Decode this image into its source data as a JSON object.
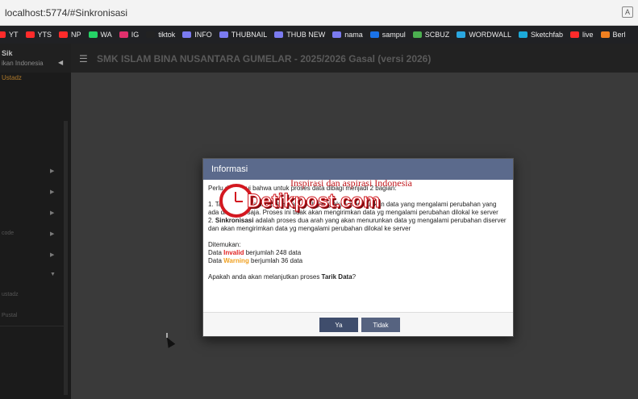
{
  "browser": {
    "url": "localhost:5774/#Sinkronisasi",
    "translate_icon": "translate-icon"
  },
  "bookmarks": [
    {
      "label": "YT",
      "color": "#ff2b2b"
    },
    {
      "label": "YTS",
      "color": "#ff2b2b"
    },
    {
      "label": "NP",
      "color": "#ff2b2b"
    },
    {
      "label": "WA",
      "color": "#25d366"
    },
    {
      "label": "IG",
      "color": "#e1306c"
    },
    {
      "label": "tiktok",
      "color": "#222222"
    },
    {
      "label": "INFO",
      "color": "#7b7bf0"
    },
    {
      "label": "THUBNAIL",
      "color": "#7b7bf0"
    },
    {
      "label": "THUB NEW",
      "color": "#7b7bf0"
    },
    {
      "label": "nama",
      "color": "#7b7bf0"
    },
    {
      "label": "sampul",
      "color": "#1a73e8"
    },
    {
      "label": "SCBUZ",
      "color": "#4caf50"
    },
    {
      "label": "WORDWALL",
      "color": "#2aa7e0"
    },
    {
      "label": "Sketchfab",
      "color": "#1caad9"
    },
    {
      "label": "live",
      "color": "#ff2b2b"
    },
    {
      "label": "Berl",
      "color": "#f08020"
    }
  ],
  "sidebar": {
    "brand": "Sik",
    "brand_sub": "ikan Indonesia",
    "subtitle": "Ustadz",
    "labels": [
      "code",
      "ustadz",
      "Pustal"
    ]
  },
  "topbar": {
    "title": "SMK ISLAM BINA NUSANTARA GUMELAR - 2025/2026 Gasal (versi 2026)"
  },
  "modal": {
    "title": "Informasi",
    "intro": "Perlu diketahui bahwa untuk proses data dibagi menjadi 2 bagian:",
    "item1": "1. Tarik Data adalah proses satu arah yang akan menurunkan data yang mengalami perubahan yang ada di server saja. Proses ini tidak akan mengirimkan data yg mengalami perubahan dilokal ke server",
    "item2_head": "Sinkronisasi",
    "item2_prefix": "2. ",
    "item2_rest": " adalah proses dua arah yang akan menurunkan data yg mengalami perubahan diserver dan akan mengirimkan data yg mengalami perubahan dilokal ke server",
    "found_label": "Ditemukan:",
    "invalid_prefix": "Data ",
    "invalid_word": "Invalid",
    "invalid_suffix": " berjumlah 248 data",
    "warning_prefix": "Data ",
    "warning_word": "Warning",
    "warning_suffix": " berjumlah 36 data",
    "question_prefix": "Apakah anda akan melanjutkan proses ",
    "question_bold": "Tarik Data",
    "question_suffix": "?",
    "btn_yes": "Ya",
    "btn_no": "Tidak"
  },
  "watermark": {
    "tagline": "Inspirasi dan aspirasi Indonesia",
    "logo": "Detikpost.com"
  }
}
